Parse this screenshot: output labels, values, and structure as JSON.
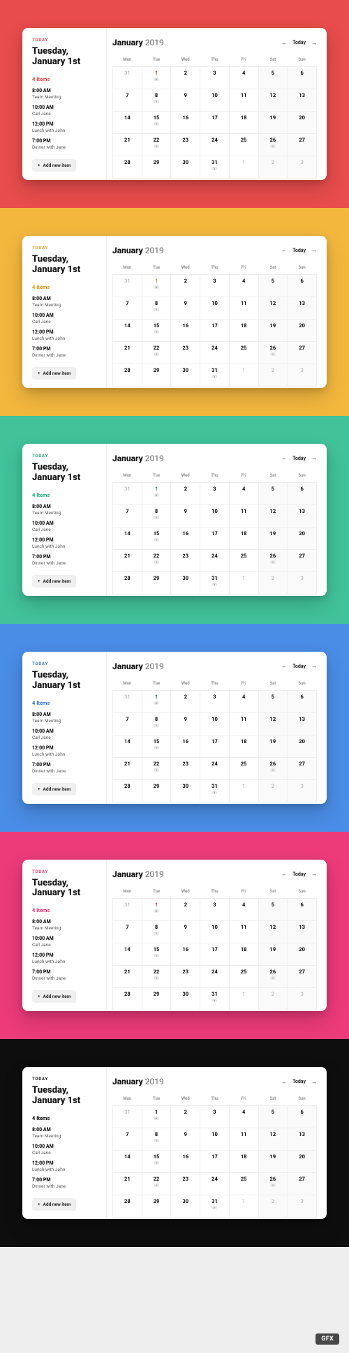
{
  "themes": [
    {
      "bg": "#e84c4c",
      "accent": "#e84c4c"
    },
    {
      "bg": "#f3b73e",
      "accent": "#d89a1f"
    },
    {
      "bg": "#41c29b",
      "accent": "#2aa87f"
    },
    {
      "bg": "#4a8de6",
      "accent": "#3a78cc"
    },
    {
      "bg": "#ec3a7a",
      "accent": "#ec3a7a"
    },
    {
      "bg": "#0e0e0e",
      "accent": "#111111"
    }
  ],
  "sidebar": {
    "today_label": "TODAY",
    "date_line1": "Tuesday,",
    "date_line2": "January 1st",
    "items_count": "4 Items",
    "agenda": [
      {
        "time": "8:00 AM",
        "desc": "Team Meeting"
      },
      {
        "time": "10:00 AM",
        "desc": "Call Jane"
      },
      {
        "time": "12:00 PM",
        "desc": "Lunch with John"
      },
      {
        "time": "7:00 PM",
        "desc": "Dinner with Jane"
      }
    ],
    "add_label": "Add new item"
  },
  "calendar": {
    "month": "January",
    "year": "2019",
    "today_btn": "Today",
    "weekdays": [
      "Mon",
      "Tue",
      "Wed",
      "Thu",
      "Fri",
      "Sat",
      "Sun"
    ],
    "weeks": [
      [
        {
          "n": "31",
          "prev": true
        },
        {
          "n": "1",
          "today": true,
          "badge": "4"
        },
        {
          "n": "2"
        },
        {
          "n": "3"
        },
        {
          "n": "4"
        },
        {
          "n": "5",
          "weekend": true
        },
        {
          "n": "6",
          "weekend": true
        }
      ],
      [
        {
          "n": "7"
        },
        {
          "n": "8",
          "badge": "1"
        },
        {
          "n": "9"
        },
        {
          "n": "10"
        },
        {
          "n": "11"
        },
        {
          "n": "12",
          "weekend": true
        },
        {
          "n": "13",
          "weekend": true
        }
      ],
      [
        {
          "n": "14"
        },
        {
          "n": "15",
          "badge": "1"
        },
        {
          "n": "16"
        },
        {
          "n": "17"
        },
        {
          "n": "18"
        },
        {
          "n": "19",
          "weekend": true
        },
        {
          "n": "20",
          "weekend": true
        }
      ],
      [
        {
          "n": "21"
        },
        {
          "n": "22",
          "badge": "1"
        },
        {
          "n": "23"
        },
        {
          "n": "24"
        },
        {
          "n": "25"
        },
        {
          "n": "26",
          "weekend": true,
          "badge": "1"
        },
        {
          "n": "27",
          "weekend": true
        }
      ],
      [
        {
          "n": "28"
        },
        {
          "n": "29"
        },
        {
          "n": "30"
        },
        {
          "n": "31",
          "badge": "1"
        },
        {
          "n": "1",
          "prev": true
        },
        {
          "n": "2",
          "prev": true,
          "weekend": true
        },
        {
          "n": "3",
          "prev": true,
          "weekend": true
        }
      ]
    ]
  },
  "watermark": "GFX"
}
